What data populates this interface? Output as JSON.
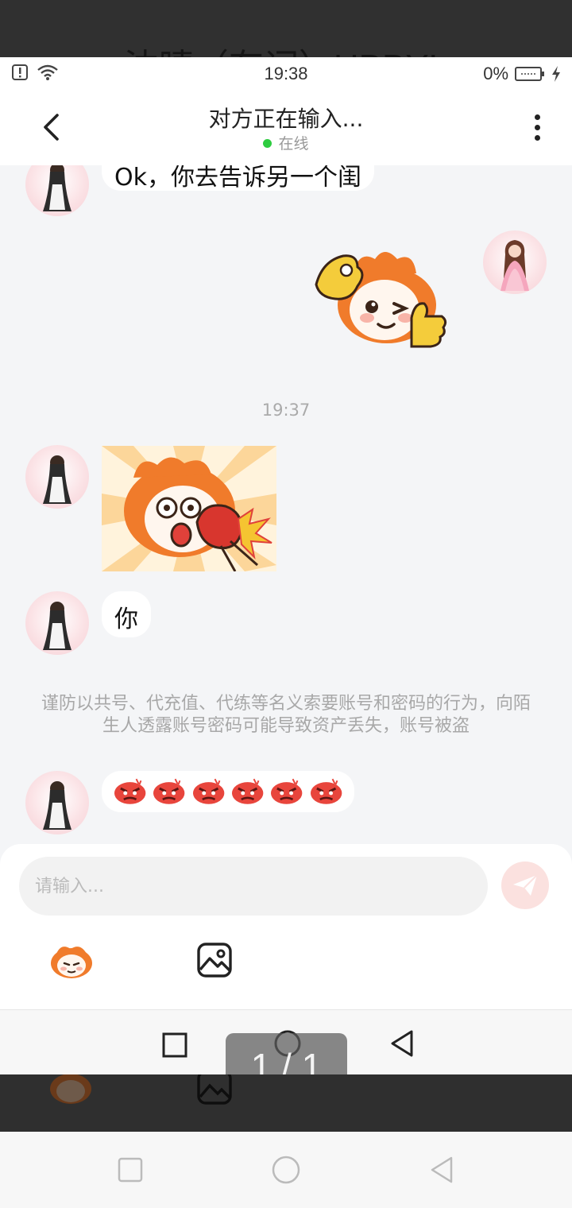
{
  "background_ghost_title": "沈晴（有词）HBBYL",
  "status_bar": {
    "time": "19:38",
    "battery_percent": "0%",
    "icons": [
      "alert-icon",
      "wifi-icon",
      "battery-icon",
      "charging-icon"
    ]
  },
  "header": {
    "title": "对方正在输入...",
    "status": "在线",
    "status_color": "#2ecc40"
  },
  "messages": [
    {
      "sender": "other",
      "type": "text",
      "text": "Ok，你去告诉另一个闺"
    },
    {
      "sender": "self",
      "type": "sticker",
      "sticker": "ok-thumbs-up-sticker"
    },
    {
      "type": "timestamp",
      "text": "19:37"
    },
    {
      "sender": "other",
      "type": "sticker",
      "sticker": "punch-sticker"
    },
    {
      "sender": "other",
      "type": "text",
      "text": "你"
    },
    {
      "type": "notice",
      "text": "谨防以共号、代充值、代练等名义索要账号和密码的行为，向陌生人透露账号密码可能导致资产丢失，账号被盗"
    },
    {
      "sender": "other",
      "type": "emoji_row",
      "emoji": "angry-face",
      "count": 6
    }
  ],
  "composer": {
    "placeholder": "请输入...",
    "send_icon": "send-icon",
    "tools": [
      "sticker-icon",
      "image-icon"
    ]
  },
  "pager": {
    "text": "1 / 1"
  },
  "colors": {
    "accent": "#f7a9a0",
    "chat_bg": "#f4f5f7",
    "bubble": "#ffffff"
  }
}
